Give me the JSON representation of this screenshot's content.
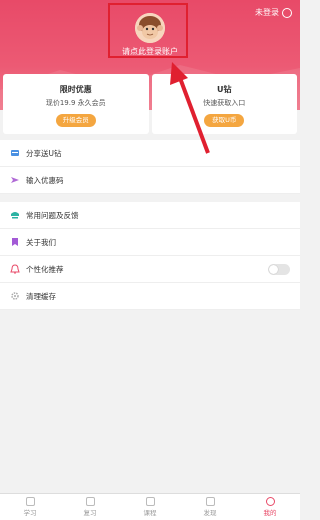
{
  "colors": {
    "brand": "#e84a68",
    "accent": "#f4a640",
    "annotation": "#e02030"
  },
  "header": {
    "login_status": "未登录",
    "login_prompt": "请点此登录账户",
    "avatar_icon": "monkey-avatar-icon"
  },
  "promo_card": {
    "title": "限时优惠",
    "subtitle": "现价19.9 永久会员",
    "button": "升级会员"
  },
  "ucoin_card": {
    "title": "U钻",
    "subtitle": "快速获取入口",
    "button": "获取U币"
  },
  "group1": [
    {
      "label": "分享送U钻",
      "icon": "share-icon"
    },
    {
      "label": "输入优惠码",
      "icon": "send-icon"
    }
  ],
  "group2": [
    {
      "label": "常用问题及反馈",
      "icon": "feedback-icon"
    },
    {
      "label": "关于我们",
      "icon": "bookmark-icon"
    },
    {
      "label": "个性化推荐",
      "icon": "bell-icon",
      "toggle": false
    },
    {
      "label": "清理缓存",
      "icon": "gear-icon"
    }
  ],
  "tabs": [
    {
      "label": "学习",
      "icon": "study-icon"
    },
    {
      "label": "复习",
      "icon": "review-icon"
    },
    {
      "label": "课程",
      "icon": "course-icon"
    },
    {
      "label": "发现",
      "icon": "discover-icon"
    },
    {
      "label": "我的",
      "icon": "profile-icon",
      "active": true
    }
  ]
}
